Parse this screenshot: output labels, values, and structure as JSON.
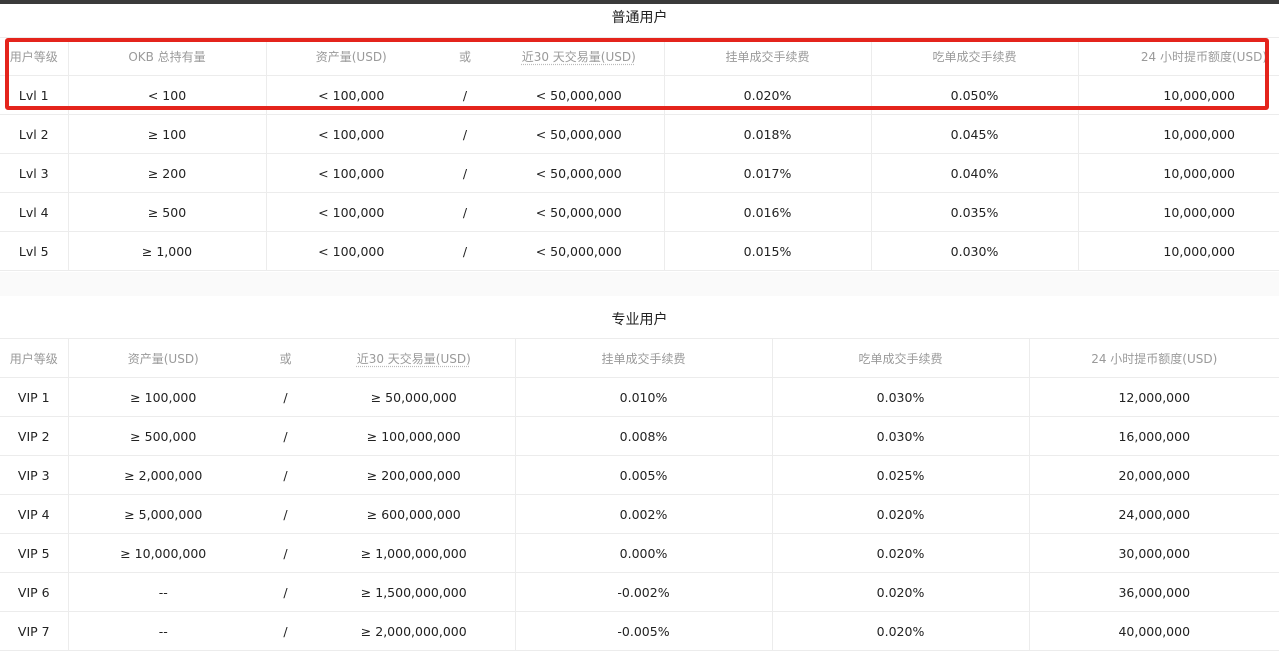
{
  "regular": {
    "title": "普通用户",
    "headers": [
      "用户等级",
      "OKB 总持有量",
      "资产量(USD)",
      "或",
      "近30 天交易量(USD)",
      "挂单成交手续费",
      "吃单成交手续费",
      "24 小时提币额度(USD)"
    ],
    "rows": [
      [
        "Lvl 1",
        "< 100",
        "< 100,000",
        "/",
        "< 50,000,000",
        "0.020%",
        "0.050%",
        "10,000,000"
      ],
      [
        "Lvl 2",
        "≥ 100",
        "< 100,000",
        "/",
        "< 50,000,000",
        "0.018%",
        "0.045%",
        "10,000,000"
      ],
      [
        "Lvl 3",
        "≥ 200",
        "< 100,000",
        "/",
        "< 50,000,000",
        "0.017%",
        "0.040%",
        "10,000,000"
      ],
      [
        "Lvl 4",
        "≥ 500",
        "< 100,000",
        "/",
        "< 50,000,000",
        "0.016%",
        "0.035%",
        "10,000,000"
      ],
      [
        "Lvl 5",
        "≥ 1,000",
        "< 100,000",
        "/",
        "< 50,000,000",
        "0.015%",
        "0.030%",
        "10,000,000"
      ]
    ]
  },
  "pro": {
    "title": "专业用户",
    "headers": [
      "用户等级",
      "资产量(USD)",
      "或",
      "近30 天交易量(USD)",
      "挂单成交手续费",
      "吃单成交手续费",
      "24 小时提币额度(USD)"
    ],
    "rows": [
      [
        "VIP 1",
        "≥ 100,000",
        "/",
        "≥ 50,000,000",
        "0.010%",
        "0.030%",
        "12,000,000"
      ],
      [
        "VIP 2",
        "≥ 500,000",
        "/",
        "≥ 100,000,000",
        "0.008%",
        "0.030%",
        "16,000,000"
      ],
      [
        "VIP 3",
        "≥ 2,000,000",
        "/",
        "≥ 200,000,000",
        "0.005%",
        "0.025%",
        "20,000,000"
      ],
      [
        "VIP 4",
        "≥ 5,000,000",
        "/",
        "≥ 600,000,000",
        "0.002%",
        "0.020%",
        "24,000,000"
      ],
      [
        "VIP 5",
        "≥ 10,000,000",
        "/",
        "≥ 1,000,000,000",
        "0.000%",
        "0.020%",
        "30,000,000"
      ],
      [
        "VIP 6",
        "--",
        "/",
        "≥ 1,500,000,000",
        "-0.002%",
        "0.020%",
        "36,000,000"
      ],
      [
        "VIP 7",
        "--",
        "/",
        "≥ 2,000,000,000",
        "-0.005%",
        "0.020%",
        "40,000,000"
      ]
    ]
  },
  "colors": {
    "highlight": "#e4241c"
  }
}
